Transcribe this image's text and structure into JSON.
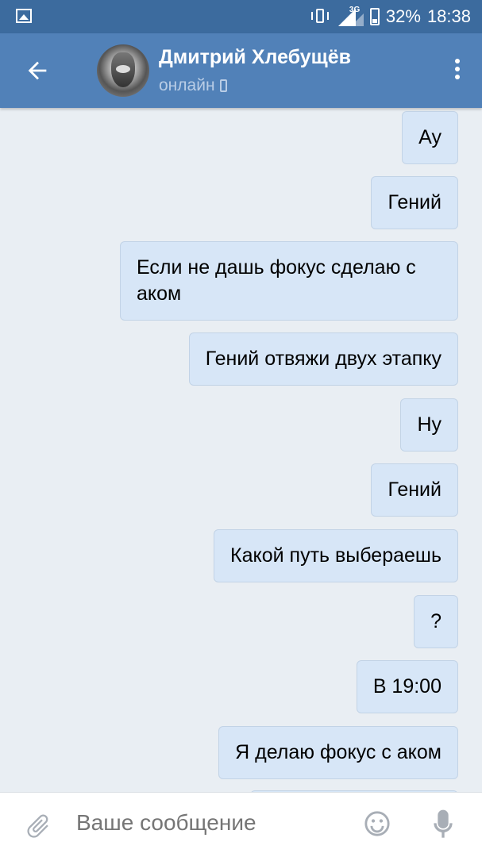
{
  "status_bar": {
    "battery": "32%",
    "time": "18:38",
    "network": "3G"
  },
  "header": {
    "contact_name": "Дмитрий Хлебущёв",
    "status": "онлайн",
    "icons": [
      "back-arrow-icon",
      "avatar",
      "mobile-icon",
      "more-vert-icon"
    ]
  },
  "messages": [
    {
      "text": "Ау"
    },
    {
      "text": "Гений"
    },
    {
      "text": "Если не дашь фокус сделаю с аком"
    },
    {
      "text": "Гений отвяжи двух этапку"
    },
    {
      "text": "Ну"
    },
    {
      "text": "Гений"
    },
    {
      "text": "Какой путь выбераешь"
    },
    {
      "text": "?"
    },
    {
      "text": "В 19:00"
    },
    {
      "text": "Я делаю фокус с аком"
    }
  ],
  "composer": {
    "placeholder": "Ваше сообщение",
    "icons": [
      "paperclip-icon",
      "emoji-icon",
      "microphone-icon"
    ]
  },
  "colors": {
    "status_bar": "#3c6b9e",
    "header": "#5181b8",
    "bubble": "#d7e6f7",
    "background": "#e9eef3"
  }
}
